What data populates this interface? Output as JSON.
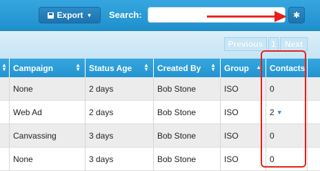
{
  "toolbar": {
    "export_label": "Export",
    "search_label": "Search:",
    "search_value": "",
    "search_placeholder": ""
  },
  "pager": {
    "previous_label": "Previous",
    "page_label": "1",
    "next_label": "Next"
  },
  "table": {
    "columns": [
      "",
      "Campaign",
      "Status Age",
      "Created By",
      "Group",
      "Contacts"
    ],
    "rows": [
      {
        "campaign": "None",
        "status_age": "2 days",
        "created_by": "Bob Stone",
        "group": "ISO",
        "contacts": "0"
      },
      {
        "campaign": "Web Ad",
        "status_age": "2 days",
        "created_by": "Bob Stone",
        "group": "ISO",
        "contacts": "2"
      },
      {
        "campaign": "Canvassing",
        "status_age": "3 days",
        "created_by": "Bob Stone",
        "group": "ISO",
        "contacts": "0"
      },
      {
        "campaign": "None",
        "status_age": "3 days",
        "created_by": "Bob Stone",
        "group": "ISO",
        "contacts": "0"
      }
    ]
  },
  "icons": {
    "export": "floppy-disk-icon",
    "settings": "gear-icon",
    "annotation_arrow": "red-arrow",
    "annotation_box": "red-highlight-box"
  },
  "colors": {
    "toolbar_bg": "#2598d5",
    "header_bg": "#2b9bd6",
    "pager_bg": "#cfe8f6",
    "annotation": "#e3201b",
    "row_alt": "#ececec"
  }
}
